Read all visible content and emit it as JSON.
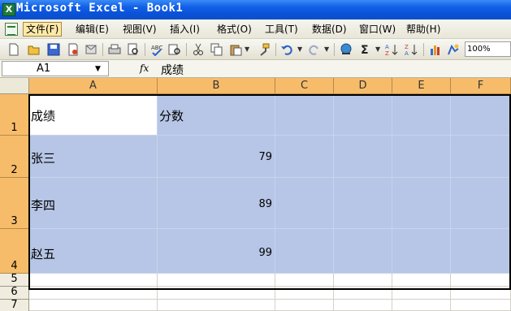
{
  "window": {
    "title": "Microsoft Excel - Book1"
  },
  "menu": {
    "items": [
      {
        "label": "文件(F)",
        "active": true
      },
      {
        "label": "编辑(E)"
      },
      {
        "label": "视图(V)"
      },
      {
        "label": "插入(I)"
      },
      {
        "label": "格式(O)"
      },
      {
        "label": "工具(T)"
      },
      {
        "label": "数据(D)"
      },
      {
        "label": "窗口(W)"
      },
      {
        "label": "帮助(H)"
      }
    ]
  },
  "toolbar": {
    "icons": [
      "new-icon",
      "open-icon",
      "save-icon",
      "permission-icon",
      "email-icon",
      "print-icon",
      "print-preview-icon",
      "spelling-icon",
      "research-icon",
      "cut-icon",
      "copy-icon",
      "paste-icon",
      "format-painter-icon",
      "undo-icon",
      "redo-icon",
      "hyperlink-icon",
      "autosum-icon",
      "sort-ascending-icon",
      "sort-descending-icon",
      "chart-wizard-icon",
      "drawing-icon"
    ],
    "zoom": "100%"
  },
  "formula_bar": {
    "name_box": "A1",
    "fx_label": "fx",
    "formula": "成绩"
  },
  "sheet": {
    "columns": [
      "A",
      "B",
      "C",
      "D",
      "E",
      "F"
    ],
    "rows": [
      {
        "num": "1",
        "cells": [
          "成绩",
          "分数",
          "",
          "",
          "",
          ""
        ]
      },
      {
        "num": "2",
        "cells": [
          "张三",
          "79",
          "",
          "",
          "",
          ""
        ]
      },
      {
        "num": "3",
        "cells": [
          "李四",
          "89",
          "",
          "",
          "",
          ""
        ]
      },
      {
        "num": "4",
        "cells": [
          "赵五",
          "99",
          "",
          "",
          "",
          ""
        ]
      },
      {
        "num": "5",
        "cells": [
          "",
          "",
          "",
          "",
          "",
          ""
        ]
      },
      {
        "num": "6",
        "cells": [
          "",
          "",
          "",
          "",
          "",
          ""
        ]
      },
      {
        "num": "7",
        "cells": [
          "",
          "",
          "",
          "",
          "",
          ""
        ]
      }
    ]
  },
  "colors": {
    "selection": "#b7c6e6",
    "header_selected": "#f7bc6a",
    "titlebar": "#0a52d8"
  }
}
